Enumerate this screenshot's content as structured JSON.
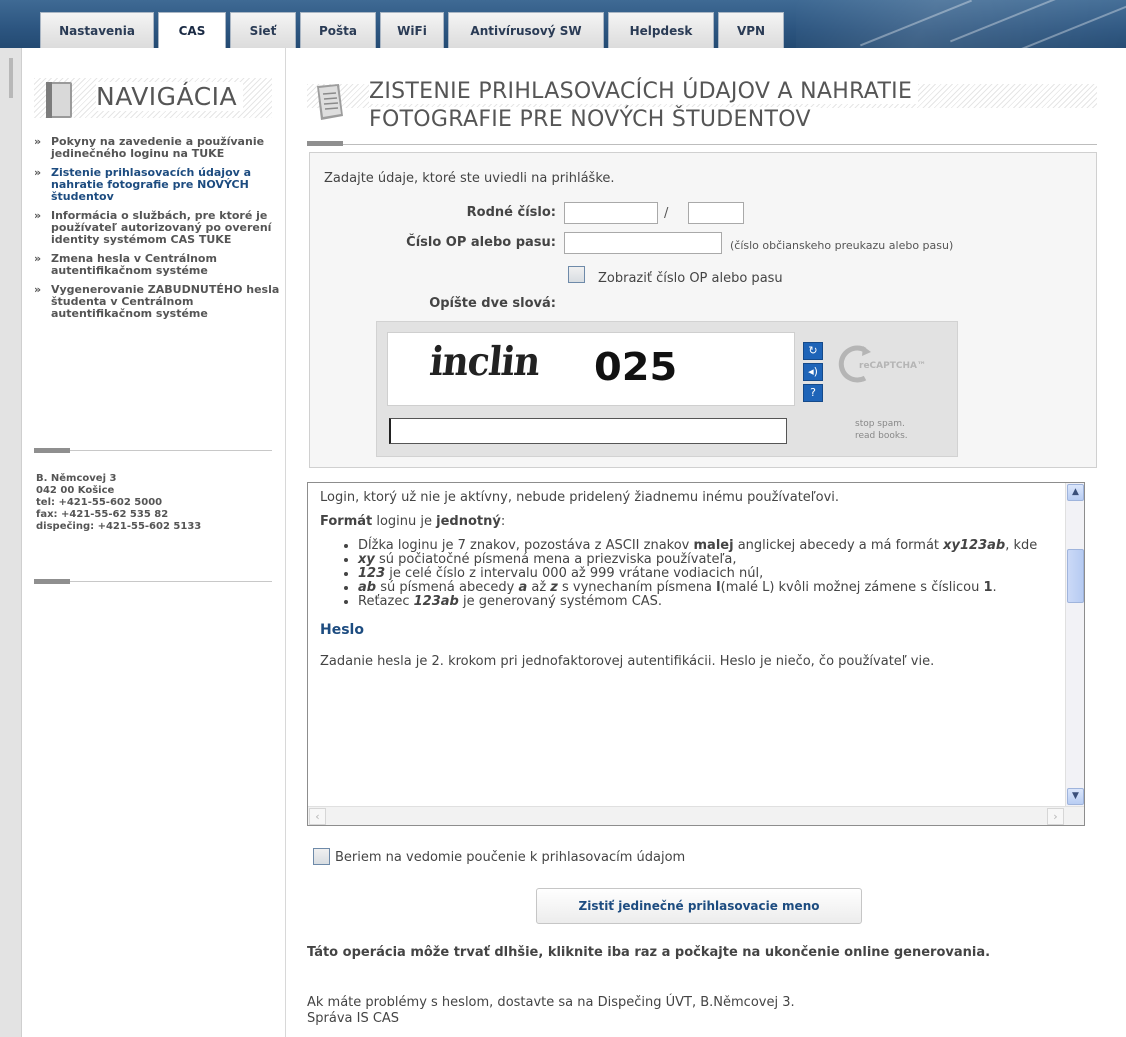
{
  "tabs": [
    {
      "label": "Nastavenia",
      "active": false
    },
    {
      "label": "CAS",
      "active": true
    },
    {
      "label": "Sieť",
      "active": false
    },
    {
      "label": "Pošta",
      "active": false
    },
    {
      "label": "WiFi",
      "active": false
    },
    {
      "label": "Antivírusový SW",
      "active": false
    },
    {
      "label": "Helpdesk",
      "active": false
    },
    {
      "label": "VPN",
      "active": false
    }
  ],
  "sidebar": {
    "title": "NAVIGÁCIA",
    "items": [
      {
        "label": "Pokyny na zavedenie a používanie jedinečného loginu na TUKE",
        "current": false
      },
      {
        "label": "Zistenie prihlasovacích údajov a nahratie fotografie pre NOVÝCH študentov",
        "current": true
      },
      {
        "label": "Informácia o službách, pre ktoré je používateľ autorizovaný po overení identity systémom CAS TUKE",
        "current": false
      },
      {
        "label": "Zmena hesla v Centrálnom autentifikačnom systéme",
        "current": false
      },
      {
        "label": "Vygenerovanie ZABUDNUTÉHO hesla študenta v Centrálnom autentifikačnom systéme",
        "current": false
      }
    ],
    "address": {
      "line1": "B. Němcovej 3",
      "line2": "042 00 Košice",
      "tel": "tel: +421-55-602 5000",
      "fax": "fax: +421-55-62 535 82",
      "dispatch": "dispečing: +421-55-602 5133"
    }
  },
  "page": {
    "title_line1": "ZISTENIE PRIHLASOVACÍCH ÚDAJOV A NAHRATIE",
    "title_line2": "FOTOGRAFIE PRE NOVÝCH ŠTUDENTOV"
  },
  "form": {
    "intro": "Zadajte údaje, ktoré ste uviedli na prihláške.",
    "birth_number_label": "Rodné číslo:",
    "birth_number_part1": "",
    "birth_number_sep": "/",
    "birth_number_part2": "",
    "id_label": "Číslo OP alebo pasu:",
    "id_value": "",
    "id_hint": "(číslo občianskeho preukazu alebo pasu)",
    "show_id_label": "Zobraziť číslo OP alebo pasu",
    "show_id_checked": false,
    "captcha_label": "Opíšte dve slová:",
    "captcha_word1": "inclin",
    "captcha_word2": "025",
    "captcha_input": "",
    "recaptcha_brand": "reCAPTCHA™",
    "recaptcha_tag1": "stop spam.",
    "recaptcha_tag2": "read books."
  },
  "terms": {
    "intro": "Login, ktorý už nie je aktívny, nebude pridelený žiadnemu inému používateľovi.",
    "format_prefix": "Formát",
    "format_middle": " loginu je ",
    "format_bold": "jednotný",
    "format_suffix": ":",
    "bullets": {
      "b1_text": "Dĺžka loginu je 7 znakov, pozostáva z ASCII znakov ",
      "b1_bold": "malej",
      "b1_text2": " anglickej abecedy a má formát ",
      "b1_code": "xy123ab",
      "b1_text3": ", kde",
      "b2_code": "xy",
      "b2_text": " sú počiatočné písmená mena a priezviska používateľa,",
      "b3_code": "123",
      "b3_text": " je celé číslo z intervalu 000 až 999 vrátane vodiacich núl,",
      "b4_code": "ab",
      "b4_text": " sú písmená abecedy ",
      "b4_a": "a",
      "b4_text2": " až ",
      "b4_z": "z",
      "b4_text3": " s vynechaním písmena ",
      "b4_l": "l",
      "b4_text4": "(malé L) kvôli možnej zámene s číslicou ",
      "b4_one": "1",
      "b4_text5": ".",
      "b5_text": "Reťazec ",
      "b5_code": "123ab",
      "b5_text2": " je generovaný systémom CAS."
    },
    "heslo_heading": "Heslo",
    "heslo_text": "Zadanie hesla je 2. krokom pri jednofaktorovej autentifikácii. Heslo je niečo, čo používateľ vie."
  },
  "ack_label": "Beriem na vedomie poučenie k prihlasovacím údajom",
  "ack_checked": false,
  "submit_label": "Zistiť jedinečné prihlasovacie meno",
  "warning": "Táto operácia môže trvať dlhšie, kliknite iba raz a počkajte na ukončenie online generovania.",
  "help_line1": "Ak máte problémy s heslom, dostavte sa na Dispečing ÚVT, B.Němcovej 3.",
  "help_line2": "Správa IS CAS",
  "colors": {
    "header_blue": "#2c5580",
    "link_blue": "#1d4c80",
    "recaptcha_blue": "#1e64b8"
  }
}
